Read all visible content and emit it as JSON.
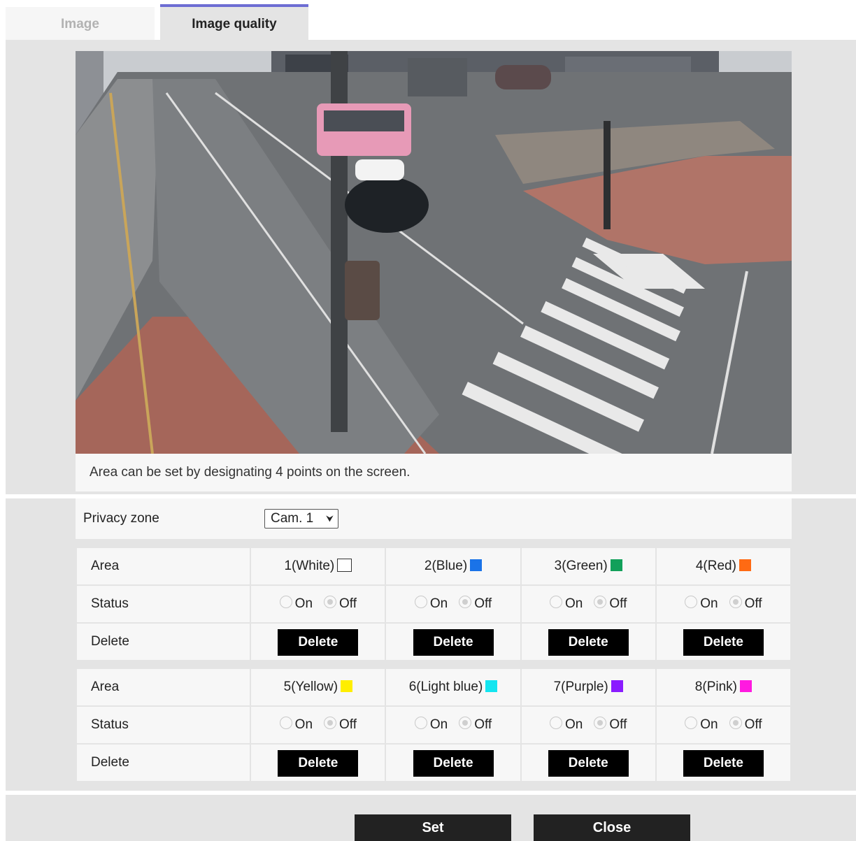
{
  "tabs": [
    {
      "label": "Image",
      "active": false
    },
    {
      "label": "Image quality",
      "active": true
    }
  ],
  "camera": {
    "caption": "Area can be set by designating 4 points on the screen."
  },
  "privacy_zone": {
    "label": "Privacy zone",
    "selected": "Cam. 1"
  },
  "rows": {
    "area_label": "Area",
    "status_label": "Status",
    "delete_label": "Delete"
  },
  "radio": {
    "on": "On",
    "off": "Off"
  },
  "areas": [
    {
      "name": "1(White)",
      "color": "#ffffff",
      "status": "Off"
    },
    {
      "name": "2(Blue)",
      "color": "#1a73e8",
      "status": "Off"
    },
    {
      "name": "3(Green)",
      "color": "#12a05a",
      "status": "Off"
    },
    {
      "name": "4(Red)",
      "color": "#ff6a13",
      "status": "Off"
    },
    {
      "name": "5(Yellow)",
      "color": "#ffee00",
      "status": "Off"
    },
    {
      "name": "6(Light blue)",
      "color": "#13e5f0",
      "status": "Off"
    },
    {
      "name": "7(Purple)",
      "color": "#8a1cff",
      "status": "Off"
    },
    {
      "name": "8(Pink)",
      "color": "#ff1ae0",
      "status": "Off"
    }
  ],
  "buttons": {
    "set": "Set",
    "close": "Close"
  }
}
